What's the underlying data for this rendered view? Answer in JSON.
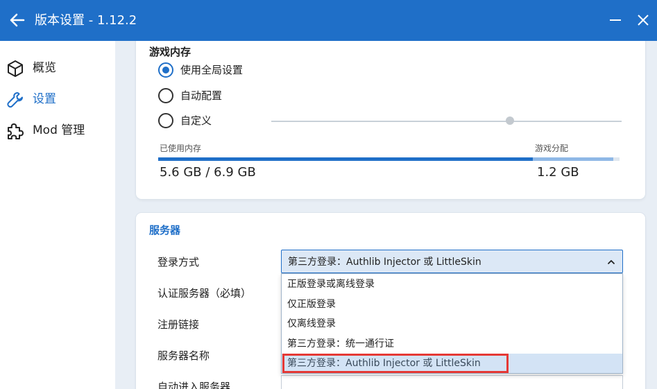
{
  "window": {
    "title": "版本设置 - 1.12.2",
    "accent_color": "#1f6fc8",
    "back_icon": "arrow-left-icon",
    "minimize_icon": "minimize-icon",
    "close_icon": "close-icon"
  },
  "sidebar": {
    "items": [
      {
        "label": "概览",
        "icon": "cube-icon",
        "active": false
      },
      {
        "label": "设置",
        "icon": "wrench-icon",
        "active": true
      },
      {
        "label": "Mod 管理",
        "icon": "puzzle-icon",
        "active": false
      }
    ]
  },
  "memory_card": {
    "title": "游戏内存",
    "options": [
      {
        "label": "使用全局设置",
        "checked": true
      },
      {
        "label": "自动配置",
        "checked": false
      },
      {
        "label": "自定义",
        "checked": false
      }
    ],
    "used_label": "已使用内存",
    "allocated_label": "游戏分配",
    "used_value": "5.6 GB / 6.9 GB",
    "allocated_value": "1.2 GB",
    "used_fraction": 0.812,
    "allocated_fraction": 0.174
  },
  "server_card": {
    "title": "服务器",
    "login_label": "登录方式",
    "login_value": "第三方登录：Authlib Injector 或 LittleSkin",
    "auth_server_label": "认证服务器（必填）",
    "register_link_label": "注册链接",
    "server_name_label": "服务器名称",
    "auto_join_label": "自动进入服务器",
    "dropdown_options": [
      {
        "label": "正版登录或离线登录",
        "selected": false
      },
      {
        "label": "仅正版登录",
        "selected": false
      },
      {
        "label": "仅离线登录",
        "selected": false
      },
      {
        "label": "第三方登录：统一通行证",
        "selected": false
      },
      {
        "label": "第三方登录：Authlib Injector 或 LittleSkin",
        "selected": true
      }
    ]
  }
}
